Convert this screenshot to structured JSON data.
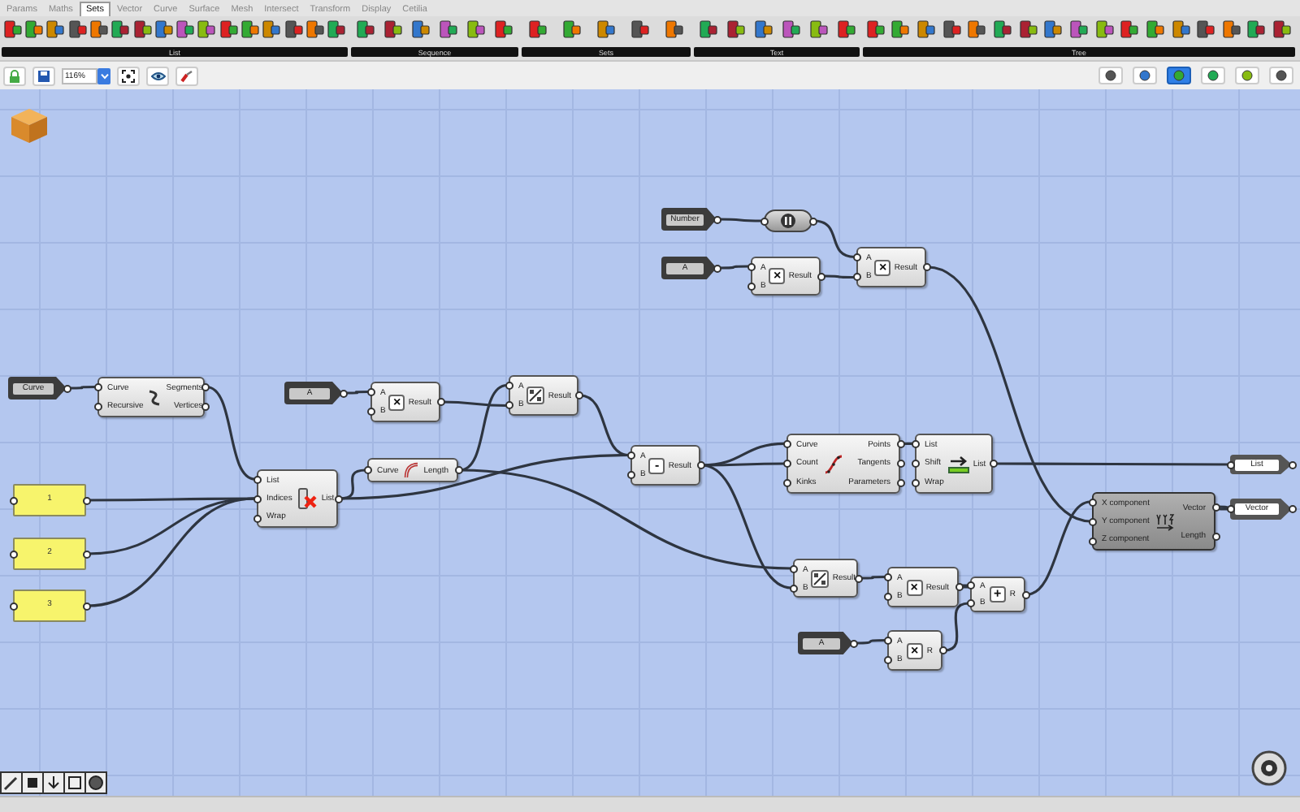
{
  "menu_tabs": [
    {
      "label": "Params",
      "selected": false
    },
    {
      "label": "Maths",
      "selected": false
    },
    {
      "label": "Sets",
      "selected": true
    },
    {
      "label": "Vector",
      "selected": false
    },
    {
      "label": "Curve",
      "selected": false
    },
    {
      "label": "Surface",
      "selected": false
    },
    {
      "label": "Mesh",
      "selected": false
    },
    {
      "label": "Intersect",
      "selected": false
    },
    {
      "label": "Transform",
      "selected": false
    },
    {
      "label": "Display",
      "selected": false
    },
    {
      "label": "Cetilia",
      "selected": false
    }
  ],
  "ribbon_groups": [
    {
      "label": "List"
    },
    {
      "label": "Sequence"
    },
    {
      "label": "Sets"
    },
    {
      "label": "Text"
    },
    {
      "label": "Tree"
    }
  ],
  "zoom": {
    "value": "116%"
  },
  "view_modes": [
    {
      "selected": false
    },
    {
      "selected": false
    },
    {
      "selected": true
    },
    {
      "selected": false
    },
    {
      "selected": false
    },
    {
      "selected": false
    }
  ],
  "nodes": [
    {
      "kind": "param",
      "label": "Number"
    },
    {
      "kind": "relay"
    },
    {
      "kind": "param",
      "label": "A"
    },
    {
      "kind": "operator",
      "inputs": [
        "A",
        "B"
      ],
      "outputs": [
        "Result"
      ],
      "symbol": "×",
      "shaded": false
    },
    {
      "kind": "operator",
      "inputs": [
        "A",
        "B"
      ],
      "outputs": [
        "Result"
      ],
      "symbol": "×",
      "shaded": false
    },
    {
      "kind": "param",
      "label": "Curve"
    },
    {
      "kind": "component",
      "inputs": [
        "Curve",
        "Recursive"
      ],
      "outputs": [
        "Segments",
        "Vertices"
      ],
      "shaded": false
    },
    {
      "kind": "param",
      "label": "A"
    },
    {
      "kind": "operator",
      "inputs": [
        "A",
        "B"
      ],
      "outputs": [
        "Result"
      ],
      "symbol": "×",
      "shaded": false
    },
    {
      "kind": "component",
      "inputs": [
        "A",
        "B"
      ],
      "outputs": [
        "Result"
      ],
      "shaded": false
    },
    {
      "kind": "component",
      "inputs": [
        "Curve"
      ],
      "outputs": [
        "Length"
      ],
      "shaded": false
    },
    {
      "kind": "component",
      "inputs": [
        "List",
        "Indices",
        "Wrap"
      ],
      "outputs": [
        "List"
      ],
      "shaded": false
    },
    {
      "kind": "operator",
      "inputs": [
        "A",
        "B"
      ],
      "outputs": [
        "Result"
      ],
      "symbol": "-",
      "shaded": false
    },
    {
      "kind": "component",
      "inputs": [
        "Curve",
        "Count",
        "Kinks"
      ],
      "outputs": [
        "Points",
        "Tangents",
        "Parameters"
      ],
      "shaded": false
    },
    {
      "kind": "component",
      "inputs": [
        "List",
        "Shift",
        "Wrap"
      ],
      "outputs": [
        "List"
      ],
      "shaded": false
    },
    {
      "kind": "output",
      "label": "List"
    },
    {
      "kind": "panel",
      "text": "1"
    },
    {
      "kind": "component",
      "inputs": [
        "X component",
        "Y component",
        "Z component"
      ],
      "outputs": [
        "Vector",
        "Length"
      ],
      "shaded": true
    },
    {
      "kind": "output",
      "label": "Vector"
    },
    {
      "kind": "panel",
      "text": "2"
    },
    {
      "kind": "panel",
      "text": "3"
    },
    {
      "kind": "component",
      "inputs": [
        "A",
        "B"
      ],
      "outputs": [
        "Result"
      ],
      "shaded": false
    },
    {
      "kind": "operator",
      "inputs": [
        "A",
        "B"
      ],
      "outputs": [
        "Result"
      ],
      "symbol": "×",
      "shaded": false
    },
    {
      "kind": "operator",
      "inputs": [
        "A",
        "B"
      ],
      "outputs": [
        "R"
      ],
      "symbol": "+",
      "shaded": false
    },
    {
      "kind": "param",
      "label": "A"
    },
    {
      "kind": "operator",
      "inputs": [
        "A",
        "B"
      ],
      "outputs": [
        "R"
      ],
      "symbol": "×",
      "shaded": false
    }
  ]
}
